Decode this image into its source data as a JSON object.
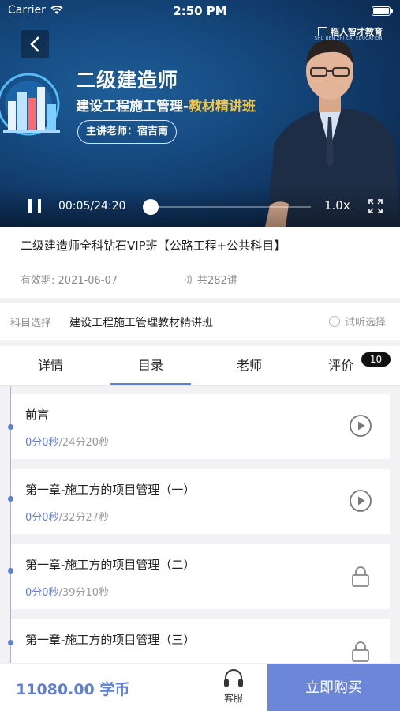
{
  "status_bar": {
    "carrier": "Carrier",
    "time": "2:50 PM"
  },
  "video": {
    "brand_name": "稻人智才教育",
    "brand_sub": "SHU REN ZHI CAI EDUCATION",
    "banner_title": "二级建造师",
    "banner_subtitle_main": "建设工程施工管理-",
    "banner_subtitle_highlight": "教材精讲班",
    "teacher_label": "主讲老师：宿吉南",
    "current_time": "00:05/24:20",
    "speed": "1.0x",
    "progress_fraction": 0.0034
  },
  "course": {
    "title": "二级建造师全科钻石VIP班【公路工程+公共科目】",
    "valid_until": "有效期:  2021-06-07",
    "lesson_count": "共282讲"
  },
  "subject": {
    "label": "科目选择",
    "value": "建设工程施工管理教材精讲班",
    "trial": "试听选择"
  },
  "tabs": [
    {
      "label": "详情"
    },
    {
      "label": "目录"
    },
    {
      "label": "老师"
    },
    {
      "label": "评价"
    }
  ],
  "review_count": "10",
  "catalog": [
    {
      "title": "前言",
      "watched": "0分0秒",
      "total": "/24分20秒",
      "action_icon": "play-circle-icon"
    },
    {
      "title": "第一章-施工方的项目管理（一）",
      "watched": "0分0秒",
      "total": "/32分27秒",
      "action_icon": "play-circle-icon"
    },
    {
      "title": "第一章-施工方的项目管理（二）",
      "watched": "0分0秒",
      "total": "/39分10秒",
      "action_icon": "lock-icon"
    },
    {
      "title": "第一章-施工方的项目管理（三）",
      "watched": "",
      "total": "",
      "action_icon": "lock-icon"
    }
  ],
  "bottom_bar": {
    "price": "11080.00 学币",
    "service_label": "客服",
    "buy_label": "立即购买"
  },
  "colors": {
    "accent": "#5f7fd6",
    "buy_button": "#6c86d8",
    "highlight": "#f5c542"
  }
}
